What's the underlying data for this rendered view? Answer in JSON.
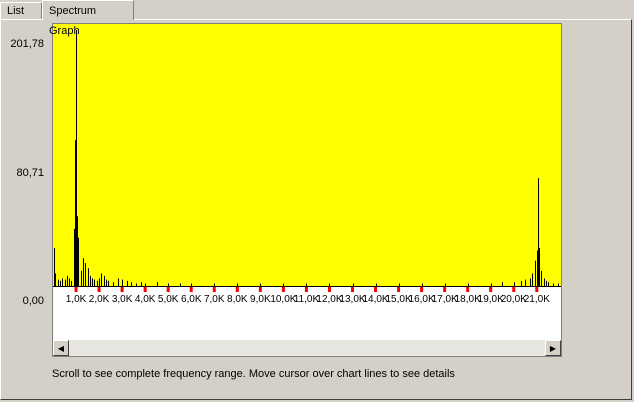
{
  "tabs": [
    {
      "label": "List",
      "active": false
    },
    {
      "label": "Spectrum Graph",
      "active": true
    }
  ],
  "y_labels": [
    "201,78",
    "80,71",
    "0,00"
  ],
  "status_text": "Scroll to see complete frequency range.  Move cursor over chart lines to see details",
  "colors": {
    "plot_background": "#ffff00",
    "bars": "#000000",
    "tick_marks": "#ff0000",
    "window": "#d4d0c8"
  },
  "chart_data": {
    "type": "bar",
    "xlabel": "",
    "ylabel": "",
    "ylim": [
      0,
      201.78
    ],
    "y_ticks": [
      201.78,
      80.71,
      0
    ],
    "x_unit": "Hz",
    "x_range": [
      0,
      22050
    ],
    "x_tick_labels": [
      "1,0K",
      "2,0K",
      "3,0K",
      "4,0K",
      "5,0K",
      "6,0K",
      "7,0K",
      "8,0K",
      "9,0K",
      "10,0K",
      "11,0K",
      "12,0K",
      "13,0K",
      "14,0K",
      "15,0K",
      "16,0K",
      "17,0K",
      "18,0K",
      "19,0K",
      "20,0K",
      "21,0K"
    ],
    "x": [
      50,
      100,
      200,
      300,
      400,
      500,
      600,
      700,
      800,
      900,
      950,
      1000,
      1050,
      1100,
      1200,
      1300,
      1400,
      1500,
      1600,
      1700,
      1800,
      1900,
      2000,
      2100,
      2200,
      2300,
      2400,
      2600,
      2800,
      3000,
      3200,
      3400,
      3600,
      3800,
      4000,
      4500,
      5000,
      5500,
      6000,
      7000,
      8000,
      9000,
      10000,
      11000,
      12000,
      13000,
      14000,
      15000,
      16000,
      17000,
      18000,
      19000,
      19500,
      20000,
      20300,
      20500,
      20700,
      20800,
      20900,
      21000,
      21050,
      21100,
      21200,
      21300,
      21400,
      21500,
      21700,
      21900
    ],
    "values": [
      30,
      10,
      5,
      4,
      6,
      5,
      8,
      6,
      4,
      45,
      115,
      201.78,
      55,
      38,
      12,
      22,
      18,
      14,
      8,
      6,
      5,
      4,
      6,
      10,
      8,
      5,
      4,
      3,
      6,
      5,
      4,
      3,
      2,
      3,
      2,
      3,
      2,
      2,
      2,
      2,
      2,
      2,
      2,
      2,
      2,
      2,
      2,
      2,
      2,
      2,
      2,
      2,
      3,
      3,
      4,
      5,
      6,
      10,
      20,
      28,
      85,
      30,
      12,
      6,
      4,
      3,
      2,
      2
    ]
  }
}
